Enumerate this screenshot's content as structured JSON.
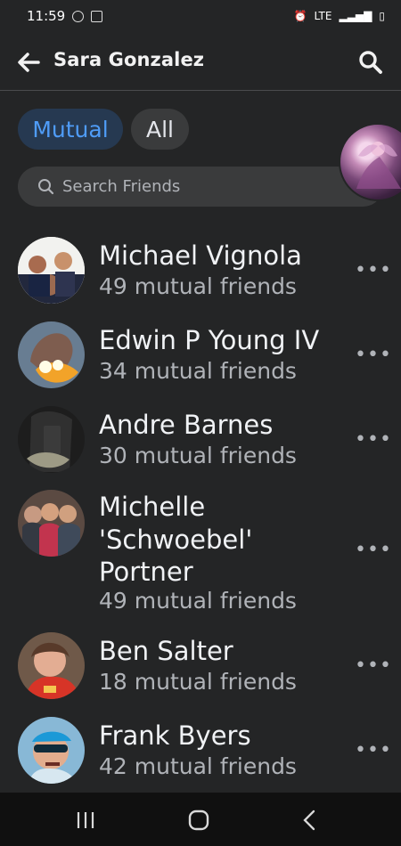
{
  "status_bar": {
    "time": "11:59",
    "network": "LTE"
  },
  "header": {
    "title": "Sara Gonzalez"
  },
  "tabs": [
    {
      "label": "Mutual",
      "selected": true
    },
    {
      "label": "All",
      "selected": false
    }
  ],
  "search": {
    "placeholder": "Search Friends"
  },
  "friends": [
    {
      "name": "Michael Vignola",
      "mutual": "49 mutual friends"
    },
    {
      "name": "Edwin P Young IV",
      "mutual": "34 mutual friends"
    },
    {
      "name": "Andre Barnes",
      "mutual": "30 mutual friends"
    },
    {
      "name": "Michelle 'Schwoebel' Portner",
      "mutual": "49 mutual friends"
    },
    {
      "name": "Ben Salter",
      "mutual": "18 mutual friends"
    },
    {
      "name": "Frank Byers",
      "mutual": "42 mutual friends"
    }
  ],
  "more_label": "•••",
  "colors": {
    "background": "#242526",
    "accent": "#4f9cf7",
    "selected_pill": "#263951",
    "secondary_text": "#b0b3b8"
  }
}
